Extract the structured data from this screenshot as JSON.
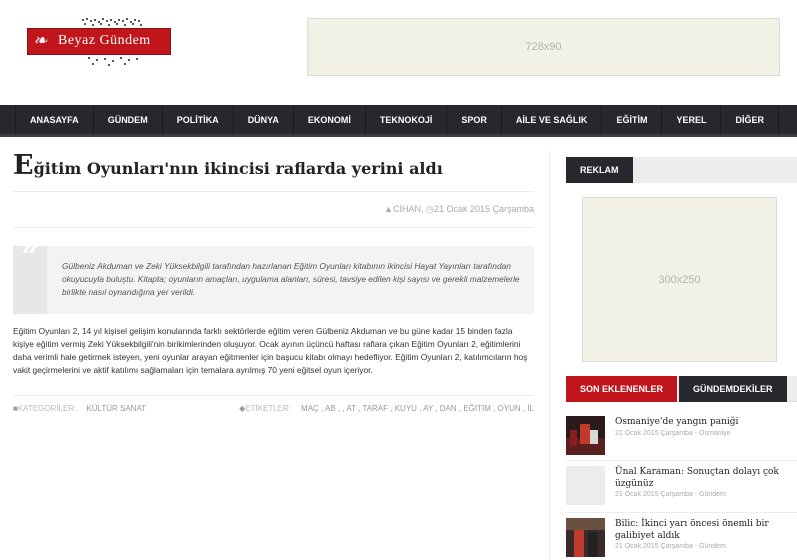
{
  "site": {
    "logo_text": "Beyaz Gündem"
  },
  "ads": {
    "top_label": "728x90",
    "side_label": "300x250"
  },
  "nav": {
    "items": [
      "ANASAYFA",
      "GÜNDEM",
      "POLİTİKA",
      "DÜNYA",
      "EKONOMİ",
      "TEKNOKOJİ",
      "SPOR",
      "AİLE VE SAĞLIK",
      "EĞİTİM",
      "YEREL",
      "DİĞER"
    ]
  },
  "article": {
    "title_first": "E",
    "title_rest": "ğitim Oyunları'nın ikincisi raflarda yerini aldı",
    "author": "CİHAN",
    "date": "21 Ocak 2015 Çarşamba",
    "quote_mark": "“",
    "quote": "Gülbeniz Akduman ve Zeki Yüksekbilgili tarafından hazırlanan Eğitim Oyunları kitabının ikincisi Hayat Yayınları tarafından okuyucuyla buluştu. Kitapta; oyunların amaçları, uygulama alanları, süresi, tavsiye edilen kişi sayısı ve gerekli malzemelerle birlikte nasıl oynandığına yer verildi.",
    "body": "Eğitim Oyunları 2, 14 yıl kişisel gelişim konularında farklı sektörlerde eğitim veren Gülbeniz Akduman ve bu güne kadar 15 binden fazla kişiye eğitim vermiş Zeki Yüksekbilgili'nin birikimlerinden oluşuyor. Ocak ayının üçüncü haftası raflara çıkan Eğitim Oyunları 2, eğitimlerini daha verimli hale getirmek isteyen, yeni oyunlar arayan eğitmenler için başucu kitabı olmayı hedefliyor. Eğitim Oyunları 2, katılımcıların hoş vakit geçirmelerini ve aktif katılımı sağlamaları için temalara ayrılmış 70 yeni eğitsel oyun içeriyor.",
    "categories_label": "KATEGORİLER:",
    "category": "KÜLTÜR SANAT",
    "tags_label": "ETİKETLER:",
    "tags": "MAÇ , AB , , AT , TARAF , KUYU , AY , DAN , EĞİTİM , OYUN , İL"
  },
  "sidebar": {
    "reklam": "REKLAM",
    "tab_latest": "SON EKLENENLER",
    "tab_agenda": "GÜNDEMDEKİLER",
    "news": [
      {
        "title": "Osmaniye'de yangın paniği",
        "meta": "21 Ocak 2015 Çarşamba - Osmaniye"
      },
      {
        "title": "Ünal Karaman: Sonuçtan dolayı çok üzgünüz",
        "meta": "21 Ocak 2015 Çarşamba - Gündem"
      },
      {
        "title": "Bilic: İkinci yarı öncesi önemli bir galibiyet aldık",
        "meta": "21 Ocak 2015 Çarşamba - Gündem"
      }
    ]
  }
}
